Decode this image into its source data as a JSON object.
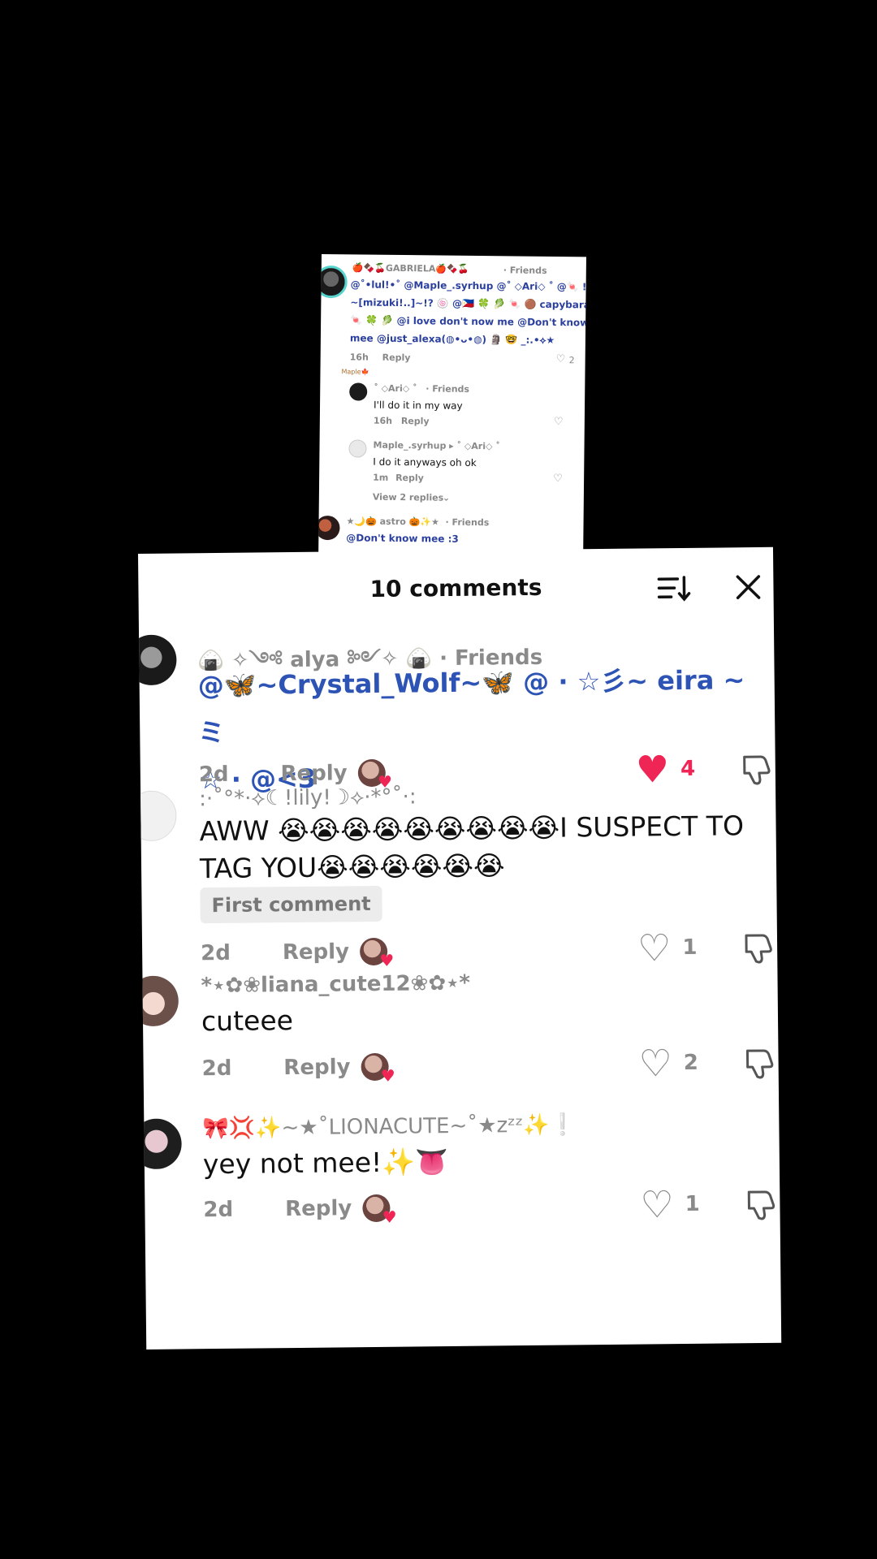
{
  "background_screenshot": {
    "c1_user": "🍎🍫🍒GABRIELA🍎🍫🍒",
    "c1_friends": "· Friends",
    "c1_line1": "@˚•lul!•˚ @Maple_.syrhup @˚ ◇Ari◇ ˚ @🍬 !?",
    "c1_line2": "~[mizuki!..]~!? 🍥 @🇵🇭 🍀 🥬 🍬 🟤 capybara",
    "c1_line3": "🍬 🍀 🥬 @i love don't now me @Don't know",
    "c1_line4": "mee @just_alexa(◍•ᴗ•◍) 🗿 🤓 _:.•⟡★",
    "c1_time": "16h",
    "c1_reply": "Reply",
    "c1_likes": "2",
    "label_maple": "Maple🍁",
    "r1_user": "˚ ◇Ari◇ ˚",
    "r1_friends": "· Friends",
    "r1_text": "I'll do it in my way",
    "r1_time": "16h",
    "r1_reply": "Reply",
    "r2_user": "Maple_.syrhup ▸ ˚ ◇Ari◇ ˚",
    "r2_text": "I do it anyways oh ok",
    "r2_time": "1m",
    "r2_reply": "Reply",
    "view_replies": "View 2 replies",
    "c2_user": "★🌙🎃 astro 🎃✨★",
    "c2_friends": "· Friends",
    "c2_text": "@Don't know mee :3"
  },
  "panel": {
    "title": "10 comments",
    "comments": [
      {
        "username": "🍙 ✧༺ alya ༻✧ 🍙",
        "friends": "· Friends",
        "text_line1": "@🦋~Crystal_Wolf~🦋 @ · ☆彡~ eira ~ミ",
        "text_line2": "☆ ·  @<3",
        "time": "2d",
        "reply": "Reply",
        "likes": "4"
      },
      {
        "username": ":·˚°*·⟡☾!lily!☽⟡·*°˚·:",
        "text": "AWW 😭😭😭😭😭😭😭😭😭I SUSPECT TO TAG YOU😭😭😭😭😭😭",
        "badge": "First comment",
        "time": "2d",
        "reply": "Reply",
        "likes": "1"
      },
      {
        "username": "*⋆✿❀liana_cute12❀✿⋆*",
        "text": "cuteee",
        "time": "2d",
        "reply": "Reply",
        "likes": "2"
      },
      {
        "username": "🎀💢✨~★˚LIONACUTE~˚★zᶻᶻ✨❕",
        "text": "yey not mee!✨👅",
        "time": "2d",
        "reply": "Reply",
        "likes": "1"
      }
    ]
  },
  "colors": {
    "tag_blue": "#2d54b5",
    "like_red": "#ef2555",
    "meta_gray": "#8a8a8a"
  }
}
